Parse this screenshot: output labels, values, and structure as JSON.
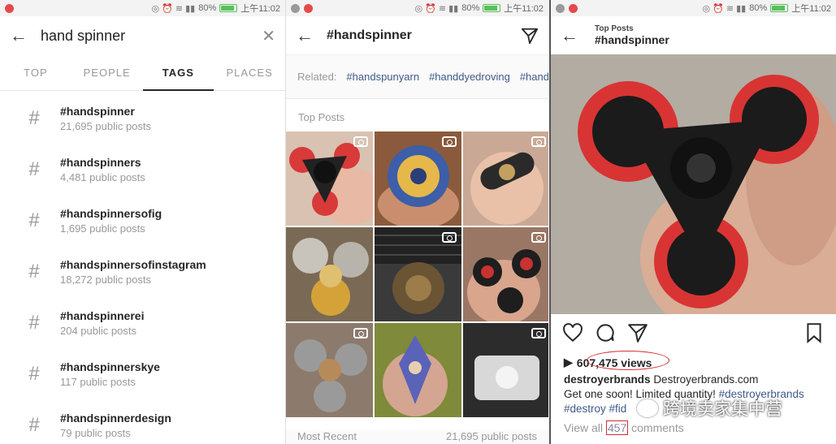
{
  "status": {
    "battery": "80%",
    "time": "上午11:02"
  },
  "search_panel": {
    "query": "hand spinner",
    "tabs": [
      "TOP",
      "PEOPLE",
      "TAGS",
      "PLACES"
    ],
    "active_tab": "TAGS",
    "results": [
      {
        "name": "#handspinner",
        "count": "21,695 public posts"
      },
      {
        "name": "#handspinners",
        "count": "4,481 public posts"
      },
      {
        "name": "#handspinnersofig",
        "count": "1,695 public posts"
      },
      {
        "name": "#handspinnersofinstagram",
        "count": "18,272 public posts"
      },
      {
        "name": "#handspinnerei",
        "count": "204 public posts"
      },
      {
        "name": "#handspinnerskye",
        "count": "117 public posts"
      },
      {
        "name": "#handspinnerdesign",
        "count": "79 public posts"
      }
    ]
  },
  "hashtag_panel": {
    "title": "#handspinner",
    "related_label": "Related:",
    "related": [
      "#handspunyarn",
      "#handdyedroving",
      "#hands"
    ],
    "top_posts_label": "Top Posts",
    "most_recent_label": "Most Recent",
    "most_recent_count": "21,695 public posts",
    "colors": {
      "link": "#3f5a8a",
      "muted": "#999999"
    }
  },
  "post_panel": {
    "subtitle": "Top Posts",
    "title": "#handspinner",
    "views": "607,475 views",
    "username": "destroyerbrands",
    "caption_name": "Destroyerbrands.com",
    "caption_text": "Get one soon! Limited quantity!",
    "caption_tag1": "#destroyerbrands",
    "caption_tag2": "#destroy",
    "caption_tag3": "#fid",
    "comments_prefix": "View all",
    "comments_count": "457",
    "comments_suffix": "comments",
    "watermark": "跨境卖家集中营",
    "colors": {
      "highlight": "#d42c2c"
    }
  }
}
